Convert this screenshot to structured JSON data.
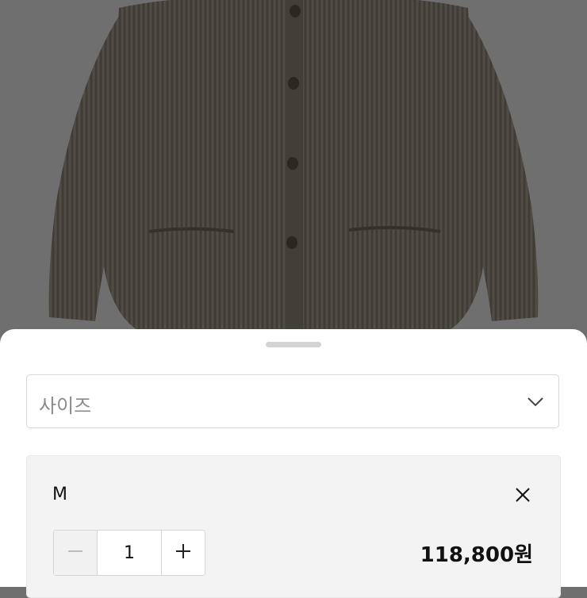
{
  "size_select": {
    "placeholder": "사이즈",
    "icon": "chevron-down-icon"
  },
  "selected_option": {
    "name": "M",
    "quantity": "1",
    "price": "118,800원",
    "icons": {
      "remove": "close-icon",
      "decrease": "minus-icon",
      "increase": "plus-icon"
    }
  },
  "colors": {
    "sheet": "#ffffff",
    "option_bg": "#f3f3f3",
    "backdrop": "#6f6f6f"
  }
}
